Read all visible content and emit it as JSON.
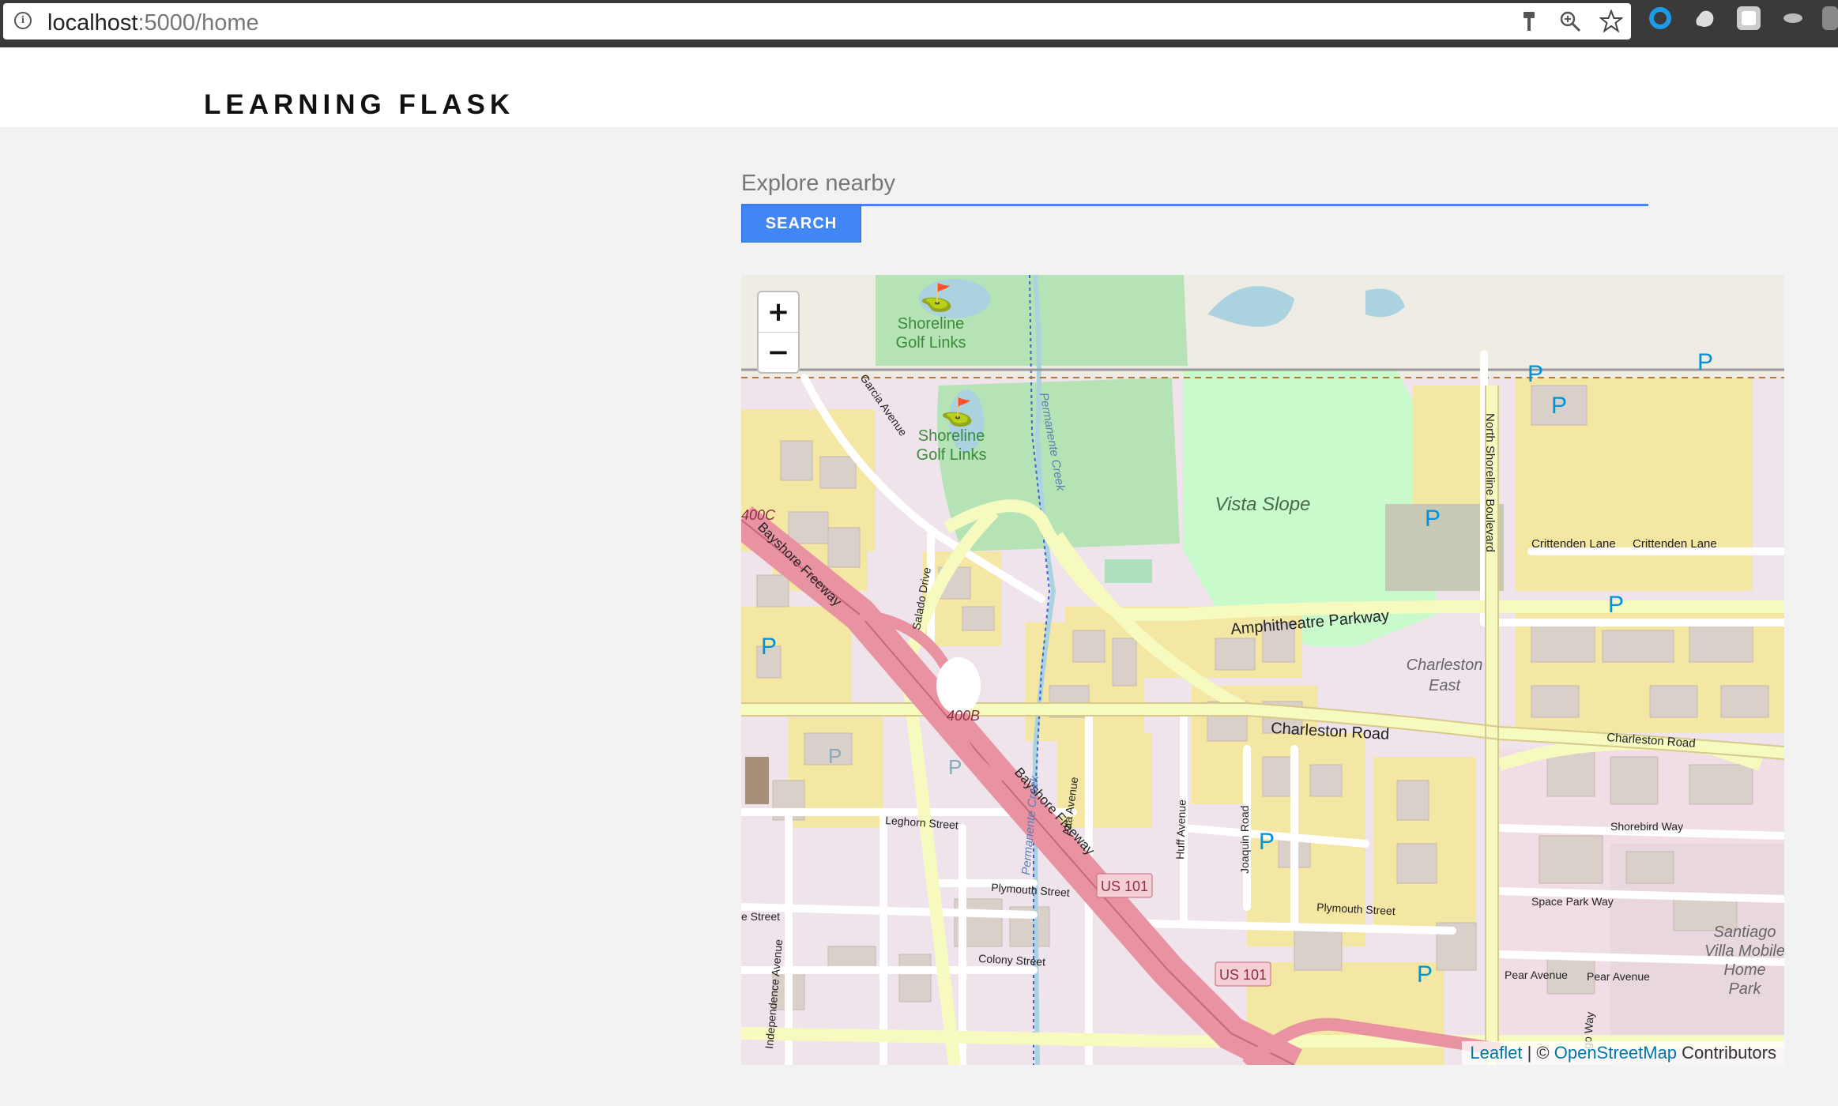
{
  "browser": {
    "url_host": "localhost",
    "url_rest": ":5000/home"
  },
  "header": {
    "brand": "LEARNING FLASK"
  },
  "search": {
    "placeholder": "Explore nearby",
    "button_label": "SEARCH"
  },
  "map": {
    "zoom_in": "+",
    "zoom_out": "−",
    "labels": {
      "shoreline_1a": "Shoreline",
      "shoreline_1b": "Golf Links",
      "shoreline_2a": "Shoreline",
      "shoreline_2b": "Golf Links",
      "vista_slope": "Vista Slope",
      "amphitheatre": "Amphitheatre Parkway",
      "charleston_road": "Charleston Road",
      "charleston_road_east": "Charleston Road",
      "charleston_east_a": "Charleston",
      "charleston_east_b": "East",
      "crittenden_1": "Crittenden Lane",
      "crittenden_2": "Crittenden Lane",
      "north_shoreline": "North Shoreline Boulevard",
      "bayshore_1": "Bayshore Freeway",
      "bayshore_2": "Bayshore Freeway",
      "us101_1": "US 101",
      "us101_2": "US 101",
      "exit_400b": "400B",
      "exit_400c": "400C",
      "leghorn": "Leghorn Street",
      "plymouth_1": "Plymouth Street",
      "plymouth_2": "Plymouth Street",
      "colony": "Colony Street",
      "shorebird": "Shorebird Way",
      "space_park": "Space Park Way",
      "pear_1": "Pear Avenue",
      "pear_2": "Pear Avenue",
      "garcia": "Garcia Avenue",
      "salado": "Salado Drive",
      "permanente_1": "Permanente Creek",
      "permanente_2": "Permanente Creek",
      "alta": "Alta Avenue",
      "huff": "Huff Avenue",
      "joaquin": "Joaquin Road",
      "independence": "Independence Avenue",
      "santiago_a": "Santiago",
      "santiago_b": "Villa Mobile",
      "santiago_c": "Home",
      "santiago_d": "Park",
      "street_left": "e Street",
      "go_way": "go Way",
      "parking": "P"
    },
    "attribution": {
      "leaflet": "Leaflet",
      "sep": " | © ",
      "osm": "OpenStreetMap",
      "contributors": " Contributors"
    }
  }
}
